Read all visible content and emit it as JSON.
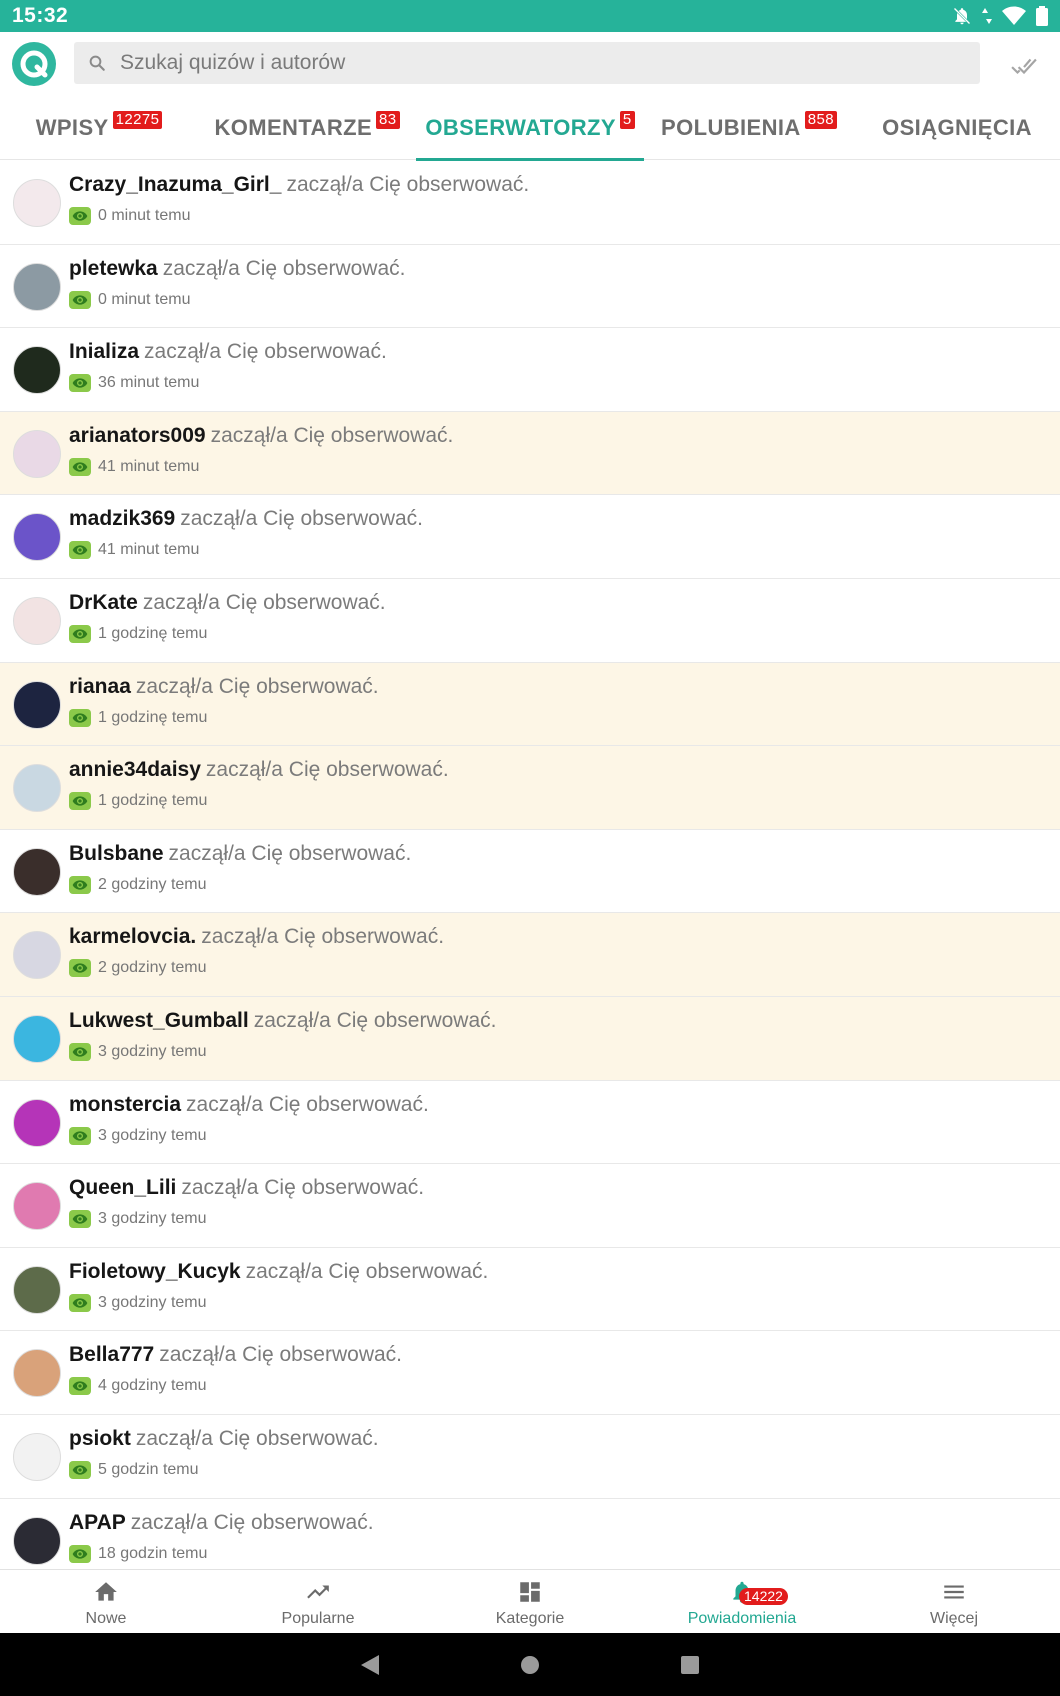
{
  "status_bar": {
    "time": "15:32"
  },
  "search": {
    "placeholder": "Szukaj quizów i autorów"
  },
  "tabs": [
    {
      "label": "WPISY",
      "badge": "12275",
      "active": false
    },
    {
      "label": "KOMENTARZE",
      "badge": "83",
      "active": false
    },
    {
      "label": "OBSERWATORZY",
      "badge": "5",
      "active": true
    },
    {
      "label": "POLUBIENIA",
      "badge": "858",
      "active": false
    },
    {
      "label": "OSIĄGNIĘCIA",
      "badge": "",
      "active": false
    }
  ],
  "action_text": "zaczął/a Cię obserwować.",
  "notifications": [
    {
      "username": "Crazy_Inazuma_Girl_",
      "time": "0 minut temu",
      "unread": false,
      "avatar_color": "#f3e9ec"
    },
    {
      "username": "pletewka",
      "time": "0 minut temu",
      "unread": false,
      "avatar_color": "#8c9aa3"
    },
    {
      "username": "Inializa",
      "time": "36 minut temu",
      "unread": false,
      "avatar_color": "#1f2a1d"
    },
    {
      "username": "arianators009",
      "time": "41 minut temu",
      "unread": true,
      "avatar_color": "#e9d9e6"
    },
    {
      "username": "madzik369",
      "time": "41 minut temu",
      "unread": false,
      "avatar_color": "#6b54c9"
    },
    {
      "username": "DrKate",
      "time": "1 godzinę temu",
      "unread": false,
      "avatar_color": "#f2e3e3"
    },
    {
      "username": "rianaa",
      "time": "1 godzinę temu",
      "unread": true,
      "avatar_color": "#1d2440"
    },
    {
      "username": "annie34daisy",
      "time": "1 godzinę temu",
      "unread": true,
      "avatar_color": "#c9d8e2"
    },
    {
      "username": "Bulsbane",
      "time": "2 godziny temu",
      "unread": false,
      "avatar_color": "#3a2e2b"
    },
    {
      "username": "karmelovcia.",
      "time": "2 godziny temu",
      "unread": true,
      "avatar_color": "#d7d7e2"
    },
    {
      "username": "Lukwest_Gumball",
      "time": "3 godziny temu",
      "unread": true,
      "avatar_color": "#3bb6e0"
    },
    {
      "username": "monstercia",
      "time": "3 godziny temu",
      "unread": false,
      "avatar_color": "#b534b8"
    },
    {
      "username": "Queen_Lili",
      "time": "3 godziny temu",
      "unread": false,
      "avatar_color": "#e07ab0"
    },
    {
      "username": "Fioletowy_Kucyk",
      "time": "3 godziny temu",
      "unread": false,
      "avatar_color": "#5d6b4a"
    },
    {
      "username": "Bella777",
      "time": "4 godziny temu",
      "unread": false,
      "avatar_color": "#d9a27a"
    },
    {
      "username": "psiokt",
      "time": "5 godzin temu",
      "unread": false,
      "avatar_color": "#f2f2f2"
    },
    {
      "username": "APAP",
      "time": "18 godzin temu",
      "unread": false,
      "avatar_color": "#2b2b34"
    }
  ],
  "bottom_nav": [
    {
      "label": "Nowe",
      "icon": "home-icon",
      "active": false
    },
    {
      "label": "Popularne",
      "icon": "trending-icon",
      "active": false
    },
    {
      "label": "Kategorie",
      "icon": "dashboard-icon",
      "active": false
    },
    {
      "label": "Powiadomienia",
      "icon": "bell-icon",
      "active": true,
      "badge": "14222"
    },
    {
      "label": "Więcej",
      "icon": "menu-icon",
      "active": false
    }
  ],
  "colors": {
    "accent": "#23a892",
    "status_bar": "#26b39a",
    "badge": "#e21c1c",
    "unread_bg": "#fdf6e6",
    "eye_badge": "#8bc94a"
  }
}
